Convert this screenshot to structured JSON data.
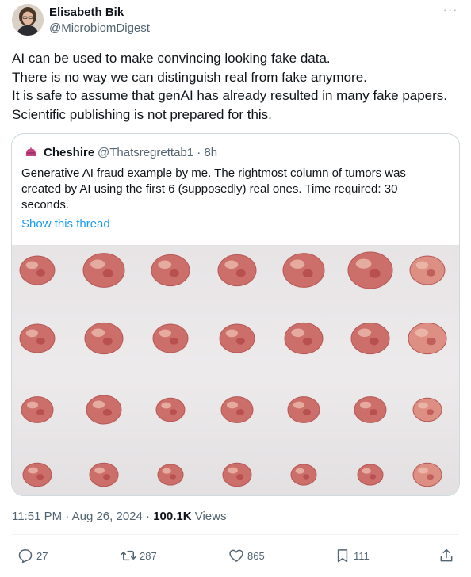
{
  "author": {
    "name": "Elisabeth Bik",
    "handle": "@MicrobiomDigest",
    "avatar_icon": "profile-photo"
  },
  "more_icon": "ellipsis-icon",
  "tweet_lines": [
    "AI can be used to make convincing looking fake data.",
    "There is no way we can distinguish real from fake anymore.",
    "It is safe to assume that genAI has already resulted in many fake papers.",
    "Scientific publishing is not prepared for this."
  ],
  "quoted": {
    "name": "Cheshire",
    "handle_time": "@Thatsregrettab1 · 8h",
    "text_lines": [
      "Generative AI fraud example by me. The rightmost column of tumors was",
      "created by AI using the first 6 (supposedly) real ones. Time required: 30",
      "seconds."
    ],
    "show_thread": "Show this thread",
    "photo": {
      "rows": 4,
      "columns": 7,
      "background": "#e8e5e7",
      "tissue_color": "#c9605f"
    }
  },
  "meta": {
    "time": "11:51 PM",
    "sep1": " · ",
    "date": "Aug 26, 2024",
    "sep2": " · ",
    "views_count": "100.1K",
    "views_label": " Views"
  },
  "actions": {
    "reply": "27",
    "retweet": "287",
    "like": "865",
    "bookmark": "111"
  },
  "colors": {
    "text": "#0f1419",
    "secondary": "#536471",
    "link": "#1d9bf0",
    "border": "#cfd9de"
  }
}
